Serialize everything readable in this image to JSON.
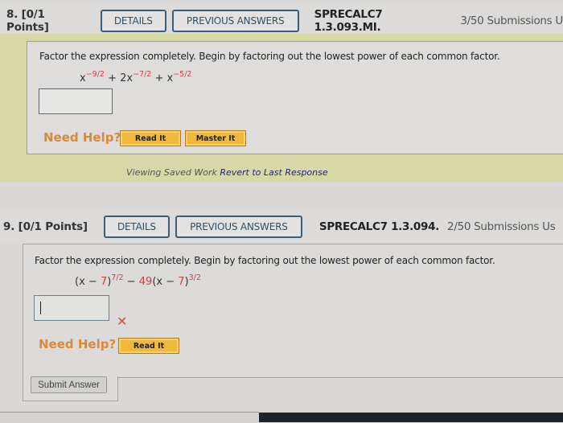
{
  "question8": {
    "number": "8.",
    "points": "[0/1 Points]",
    "details_label": "DETAILS",
    "previous_answers_label": "PREVIOUS ANSWERS",
    "problem_id": "SPRECALC7 1.3.093.MI.",
    "submissions": "3/50 Submissions U",
    "prompt": "Factor the expression completely. Begin by factoring out the lowest power of each common factor.",
    "expression": {
      "t1_base": "x",
      "t1_exp": "−9/2",
      "plus1": " + ",
      "t2_coef": "2x",
      "t2_exp": "−7/2",
      "plus2": " + ",
      "t3_base": "x",
      "t3_exp": "−5/2"
    },
    "answer_value": "",
    "need_help_label": "Need Help?",
    "read_it_label": "Read It",
    "master_it_label": "Master It",
    "viewing_saved_label": "Viewing Saved Work",
    "revert_label": "Revert to Last Response"
  },
  "question9": {
    "number": "9.",
    "points": "[0/1 Points]",
    "details_label": "DETAILS",
    "previous_answers_label": "PREVIOUS ANSWERS",
    "problem_id": "SPRECALC7 1.3.094.",
    "submissions": "2/50 Submissions Us",
    "prompt": "Factor the expression completely. Begin by factoring out the lowest power of each common factor.",
    "expression": {
      "open1": "(x − ",
      "c1": "7",
      "close1": ")",
      "exp1": "7/2",
      "minus": " − ",
      "coef": "49",
      "open2": "(x − ",
      "c2": "7",
      "close2": ")",
      "exp2": "3/2"
    },
    "answer_value": "",
    "status": "incorrect",
    "status_icon": "✕",
    "need_help_label": "Need Help?",
    "read_it_label": "Read It"
  },
  "submit_label": "Submit Answer",
  "colors": {
    "accent_button_border": "#3b5e78",
    "help_orange": "#d9893a",
    "help_button_yellow": "#f0b93b",
    "math_red": "#d0403f",
    "incorrect_red": "#d84a4a",
    "saved_bg": "#d6d8a6"
  }
}
